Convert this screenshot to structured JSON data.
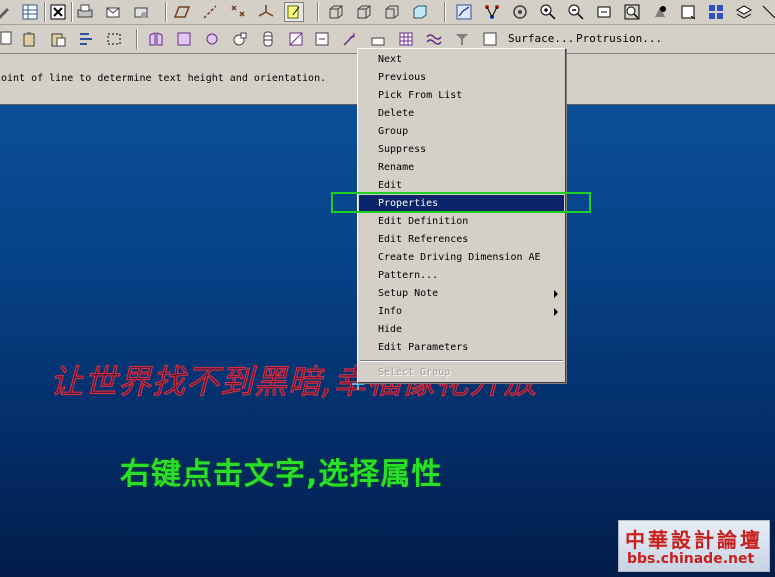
{
  "toolbar2": {
    "surface_label": "Surface...",
    "protrusion_label": "Protrusion..."
  },
  "message": {
    "text": "oint of line to determine text height and orientation."
  },
  "context_menu": {
    "items": [
      {
        "label": "Next"
      },
      {
        "label": "Previous"
      },
      {
        "label": "Pick From List"
      },
      {
        "label": "Delete"
      },
      {
        "label": "Group"
      },
      {
        "label": "Suppress"
      },
      {
        "label": "Rename"
      },
      {
        "label": "Edit"
      },
      {
        "label": "Properties",
        "selected": true
      },
      {
        "label": "Edit Definition"
      },
      {
        "label": "Edit References"
      },
      {
        "label": "Create Driving Dimension AE"
      },
      {
        "label": "Pattern..."
      },
      {
        "label": "Setup Note",
        "submenu": true
      },
      {
        "label": "Info",
        "submenu": true
      },
      {
        "label": "Hide"
      },
      {
        "label": "Edit Parameters"
      }
    ],
    "disabled_item": "Select Group"
  },
  "canvas": {
    "red_text": "让世界找不到黑暗,幸福像花开放",
    "green_text": "右键点击文字,选择属性"
  },
  "watermark": {
    "line1": "中華設計論壇",
    "line2": "bbs.chinade.net"
  },
  "colors": {
    "viewport_top": "#0c4f98",
    "viewport_bottom": "#021c4a",
    "menu_selected": "#0a246a",
    "highlight_box": "#20d020",
    "red_text": "#e03040",
    "green_text": "#28e028",
    "watermark_red": "#c8201c"
  },
  "icons": [
    "pencil-icon",
    "spreadsheet-icon",
    "close-window-icon",
    "printer-icon",
    "mail-icon",
    "mail-open-icon",
    "datum-plane-icon",
    "datum-axis-icon",
    "datum-point-icon",
    "coord-sys-icon",
    "sketch-icon",
    "view-box-icon",
    "view-front-icon",
    "view-side-icon",
    "shaded-icon",
    "analysis-icon",
    "network-icon",
    "orient-icon",
    "zoom-in-icon",
    "zoom-out-icon",
    "refit-icon",
    "zoom-box-icon",
    "spin-icon",
    "repaint-icon",
    "layer-icon",
    "copy-icon",
    "paste-icon",
    "paste-special-icon",
    "regen-icon",
    "select-box-icon",
    "mirror-icon",
    "round-icon",
    "chamfer-icon",
    "hole-icon",
    "shell-icon",
    "rib-icon",
    "draft-icon",
    "note-icon",
    "table-icon",
    "wave-icon",
    "funnel-icon",
    "checkbox-icon",
    "cursor-icon"
  ]
}
